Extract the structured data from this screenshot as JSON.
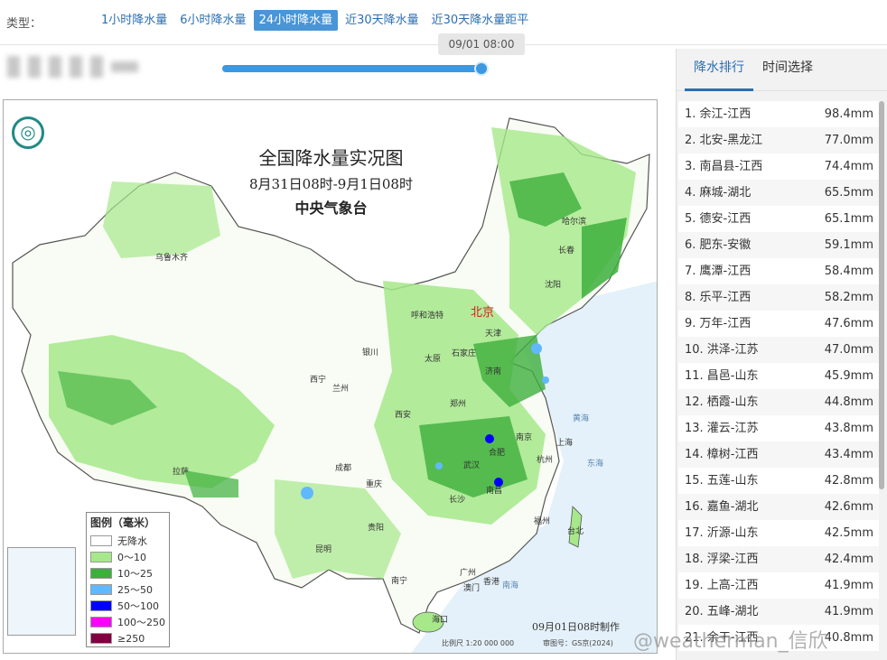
{
  "toolbar": {
    "type_label": "类型：",
    "tabs": [
      {
        "label": "1小时降水量"
      },
      {
        "label": "6小时降水量"
      },
      {
        "label": "24小时降水量",
        "active": true
      },
      {
        "label": "近30天降水量"
      },
      {
        "label": "近30天降水量距平"
      }
    ]
  },
  "timeline": {
    "current_time": "09/01 08:00",
    "progress": 1.0
  },
  "map": {
    "title": "全国降水量实况图",
    "subtitle": "8月31日08时-9月1日08时",
    "org": "中央气象台",
    "made_at": "09月01日08时制作",
    "scale": "比例尺 1:20 000 000",
    "approval": "审图号：GS京(2024)",
    "legend": {
      "title": "图例（毫米）",
      "items": [
        {
          "label": "无降水",
          "color": "#ffffff"
        },
        {
          "label": "0～10",
          "color": "#a6e88a"
        },
        {
          "label": "10～25",
          "color": "#3daf3c"
        },
        {
          "label": "25～50",
          "color": "#61b8ff"
        },
        {
          "label": "50～100",
          "color": "#0000fe"
        },
        {
          "label": "100～250",
          "color": "#fa00fa"
        },
        {
          "label": "≥250",
          "color": "#800040"
        }
      ]
    },
    "cities": [
      {
        "name": "北京",
        "highlight": true
      },
      {
        "name": "乌鲁木齐"
      },
      {
        "name": "哈尔滨"
      },
      {
        "name": "长春"
      },
      {
        "name": "沈阳"
      },
      {
        "name": "呼和浩特"
      },
      {
        "name": "天津"
      },
      {
        "name": "石家庄"
      },
      {
        "name": "太原"
      },
      {
        "name": "银川"
      },
      {
        "name": "济南"
      },
      {
        "name": "西宁"
      },
      {
        "name": "兰州"
      },
      {
        "name": "郑州"
      },
      {
        "name": "西安"
      },
      {
        "name": "南京"
      },
      {
        "name": "上海"
      },
      {
        "name": "合肥"
      },
      {
        "name": "杭州"
      },
      {
        "name": "武汉"
      },
      {
        "name": "成都"
      },
      {
        "name": "重庆"
      },
      {
        "name": "拉萨"
      },
      {
        "name": "长沙"
      },
      {
        "name": "南昌"
      },
      {
        "name": "福州"
      },
      {
        "name": "台北"
      },
      {
        "name": "贵阳"
      },
      {
        "name": "昆明"
      },
      {
        "name": "南宁"
      },
      {
        "name": "广州"
      },
      {
        "name": "香港"
      },
      {
        "name": "澳门"
      },
      {
        "name": "海口"
      }
    ],
    "seas": [
      "黄海",
      "东海",
      "南海"
    ]
  },
  "side": {
    "tabs": [
      {
        "label": "降水排行",
        "active": true
      },
      {
        "label": "时间选择"
      }
    ],
    "ranking": [
      {
        "name": "1. 余江-江西",
        "value": "98.4mm"
      },
      {
        "name": "2. 北安-黑龙江",
        "value": "77.0mm"
      },
      {
        "name": "3. 南昌县-江西",
        "value": "74.4mm"
      },
      {
        "name": "4. 麻城-湖北",
        "value": "65.5mm"
      },
      {
        "name": "5. 德安-江西",
        "value": "65.1mm"
      },
      {
        "name": "6. 肥东-安徽",
        "value": "59.1mm"
      },
      {
        "name": "7. 鹰潭-江西",
        "value": "58.4mm"
      },
      {
        "name": "8. 乐平-江西",
        "value": "58.2mm"
      },
      {
        "name": "9. 万年-江西",
        "value": "47.6mm"
      },
      {
        "name": "10. 洪泽-江苏",
        "value": "47.0mm"
      },
      {
        "name": "11. 昌邑-山东",
        "value": "45.9mm"
      },
      {
        "name": "12. 栖霞-山东",
        "value": "44.8mm"
      },
      {
        "name": "13. 灌云-江苏",
        "value": "43.8mm"
      },
      {
        "name": "14. 樟树-江西",
        "value": "43.4mm"
      },
      {
        "name": "15. 五莲-山东",
        "value": "42.8mm"
      },
      {
        "name": "16. 嘉鱼-湖北",
        "value": "42.6mm"
      },
      {
        "name": "17. 沂源-山东",
        "value": "42.5mm"
      },
      {
        "name": "18. 浮梁-江西",
        "value": "42.4mm"
      },
      {
        "name": "19. 上高-江西",
        "value": "41.9mm"
      },
      {
        "name": "20. 五峰-湖北",
        "value": "41.9mm"
      },
      {
        "name": "21. 余干-江西",
        "value": "40.8mm"
      }
    ]
  },
  "watermark": "@weatherman_信欣"
}
